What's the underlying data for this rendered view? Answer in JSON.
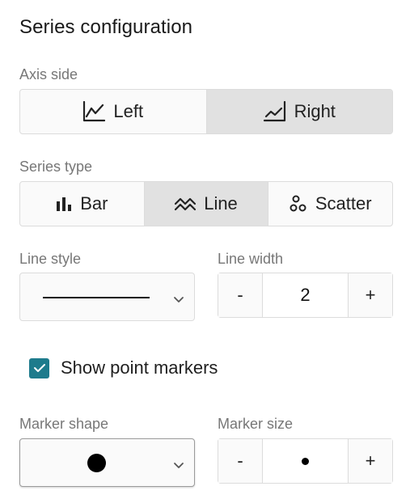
{
  "panel": {
    "title": "Series configuration"
  },
  "axis_side": {
    "label": "Axis side",
    "options": [
      {
        "label": "Left",
        "icon": "line-chart-left-icon",
        "selected": false
      },
      {
        "label": "Right",
        "icon": "line-chart-right-icon",
        "selected": true
      }
    ]
  },
  "series_type": {
    "label": "Series type",
    "options": [
      {
        "label": "Bar",
        "icon": "bar-chart-icon",
        "selected": false
      },
      {
        "label": "Line",
        "icon": "line-zigzag-icon",
        "selected": true
      },
      {
        "label": "Scatter",
        "icon": "scatter-icon",
        "selected": false
      }
    ]
  },
  "line_style": {
    "label": "Line style",
    "value": "solid",
    "icon": "solid-line-swatch"
  },
  "line_width": {
    "label": "Line width",
    "value": "2",
    "decrement": "-",
    "increment": "+"
  },
  "show_markers": {
    "label": "Show point markers",
    "checked": true,
    "accent": "#1e7b8c"
  },
  "marker_shape": {
    "label": "Marker shape",
    "value": "circle",
    "icon": "filled-circle-icon"
  },
  "marker_size": {
    "label": "Marker size",
    "value": "small",
    "icon": "small-dot-icon",
    "decrement": "-",
    "increment": "+"
  }
}
